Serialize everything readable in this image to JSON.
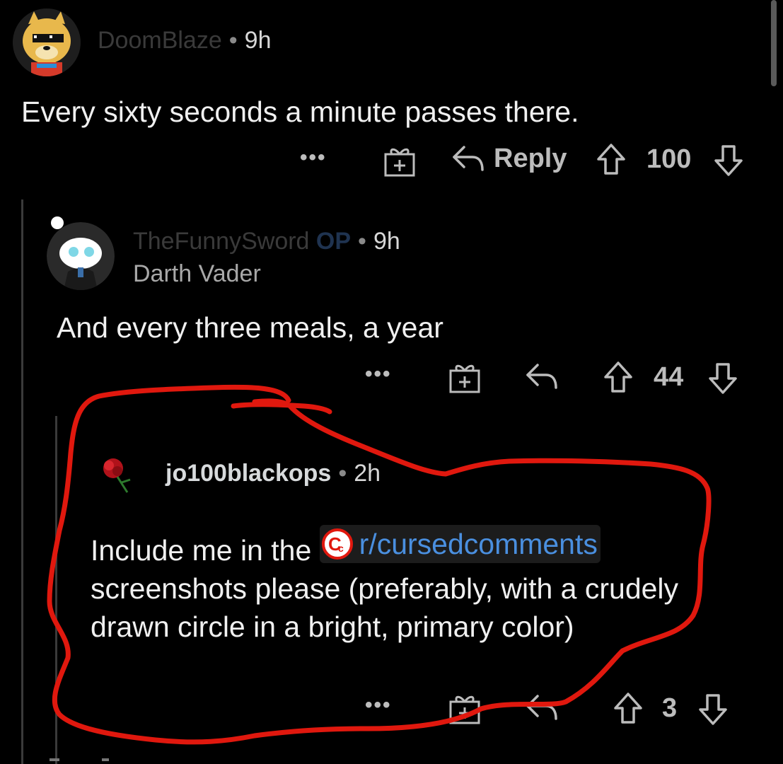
{
  "comments": [
    {
      "username": "DoomBlaze",
      "age": "9h",
      "body": "Every sixty seconds a minute passes there.",
      "actions": {
        "more": "•••",
        "reply_label": "Reply",
        "score": "100"
      }
    },
    {
      "username": "TheFunnySword",
      "op_badge": "OP",
      "age": "9h",
      "flair": "Darth Vader",
      "body": "And every three meals, a year",
      "actions": {
        "more": "•••",
        "score": "44"
      }
    },
    {
      "username": "jo100blackops",
      "age": "2h",
      "body_prefix": "Include me in the",
      "subreddit_link": "r/cursedcomments",
      "body_suffix": "screenshots please (preferably, with a crudely drawn circle in a bright, primary color)",
      "actions": {
        "more": "•••",
        "score": "3"
      }
    }
  ],
  "separator": "•",
  "icons": {
    "more": "more-dots-icon",
    "award": "award-gift-icon",
    "reply": "reply-arrow-icon",
    "upvote": "upvote-arrow-icon",
    "downvote": "downvote-arrow-icon"
  },
  "colors": {
    "background": "#000000",
    "link": "#4a8fdf",
    "annotation": "#e0180e"
  }
}
